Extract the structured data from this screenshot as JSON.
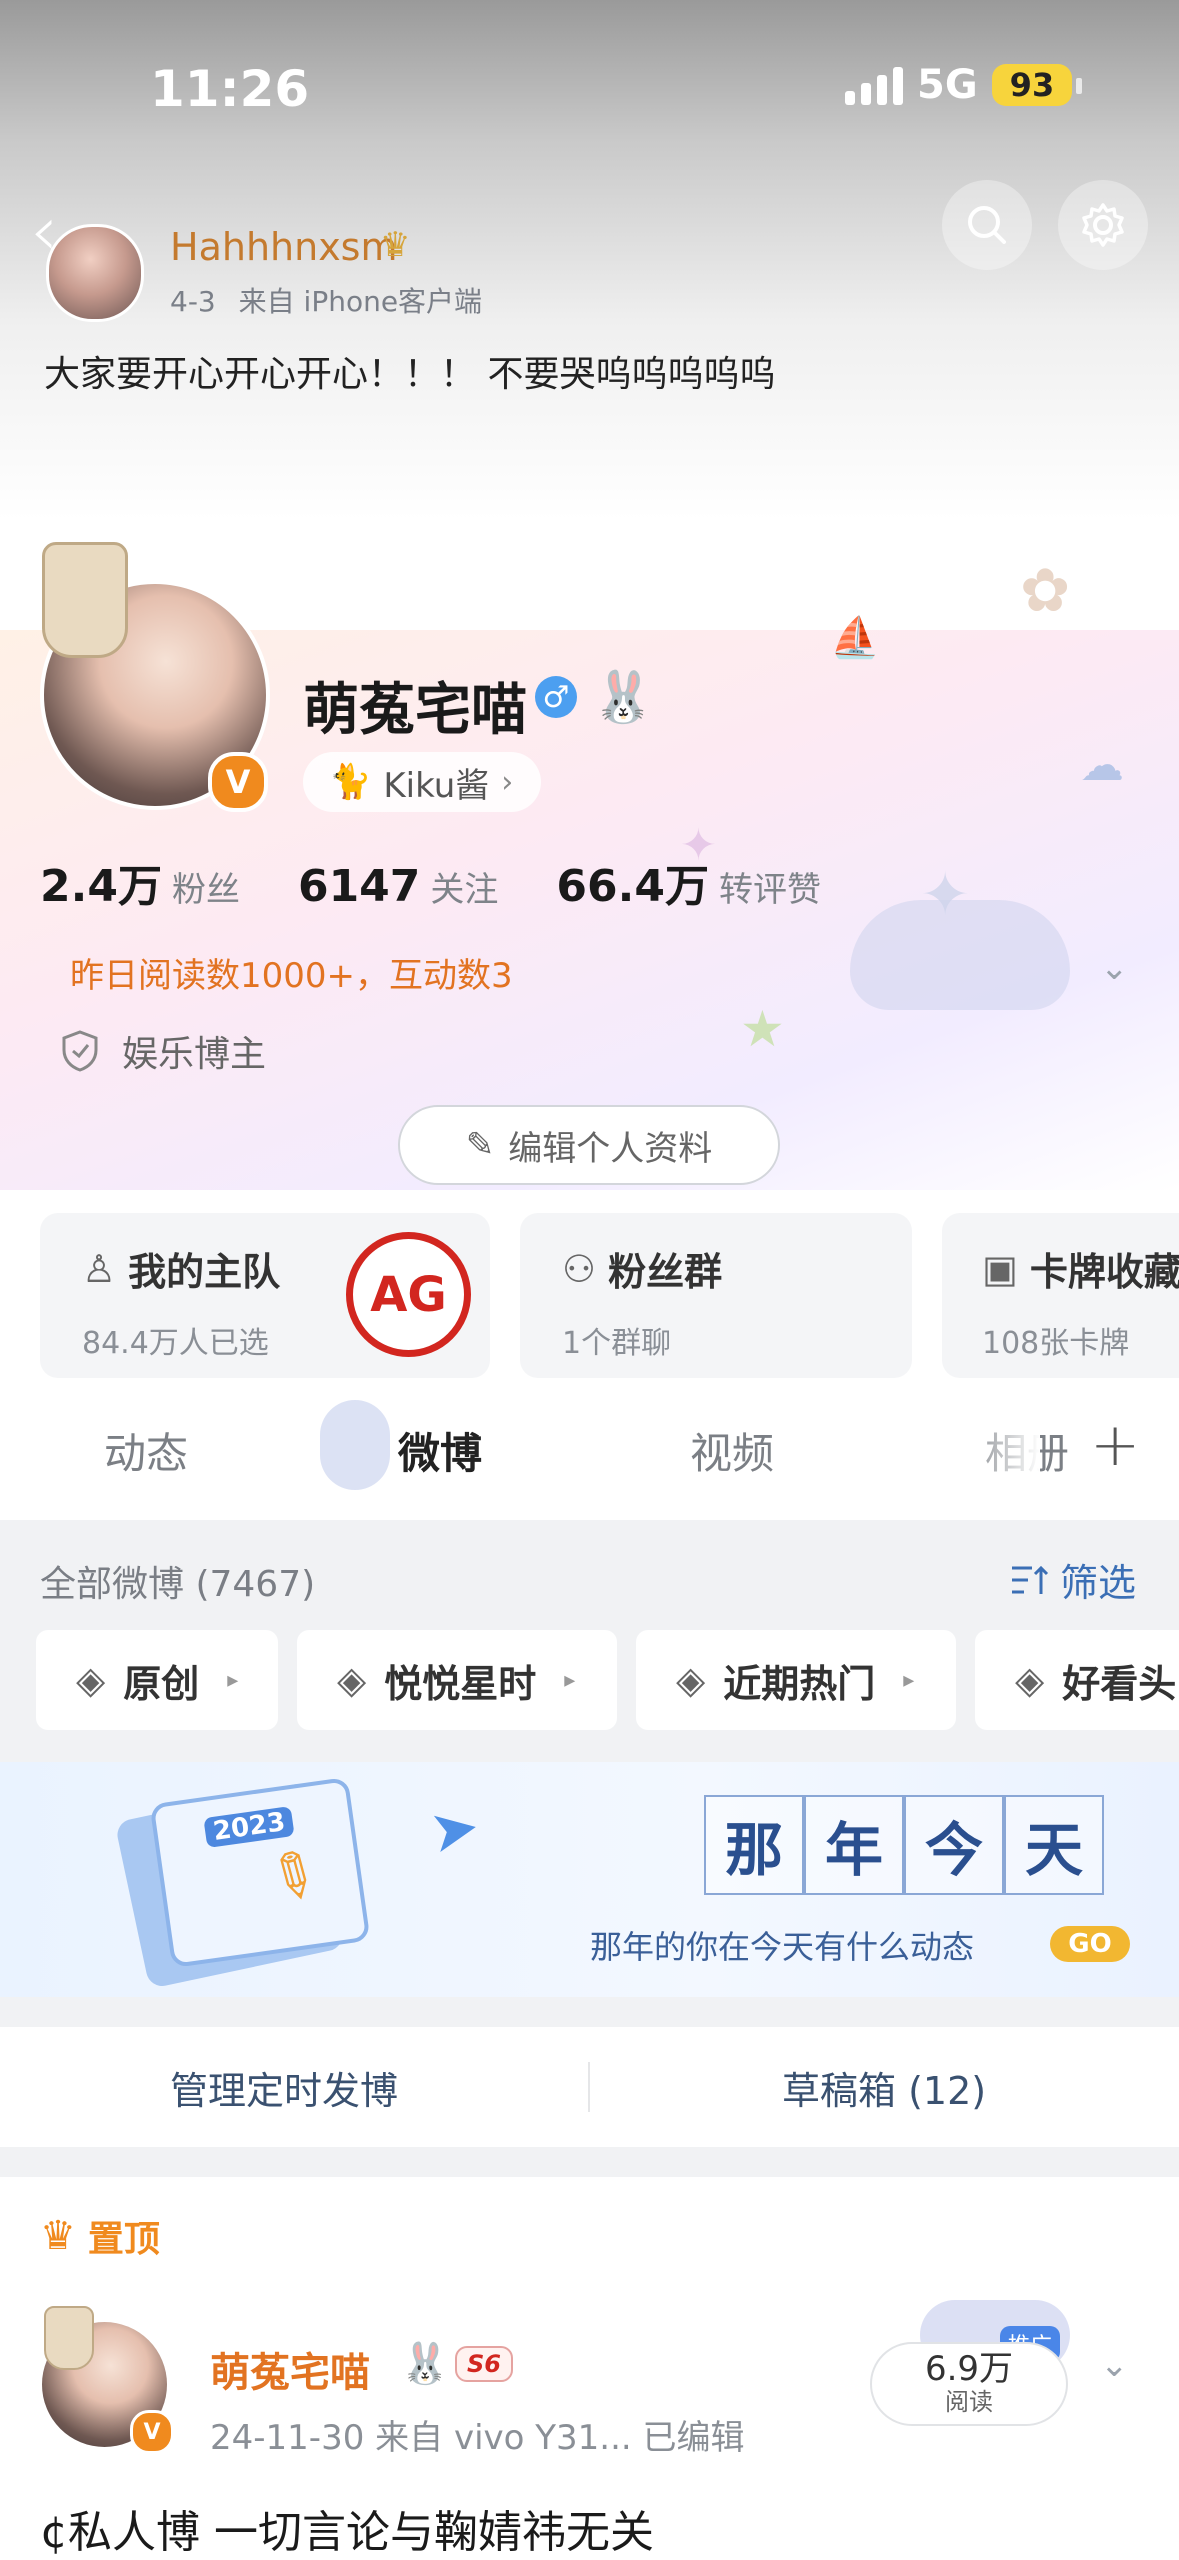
{
  "status_bar": {
    "time": "11:26",
    "network": "5G",
    "battery": "93"
  },
  "repost": {
    "author": "Hahhhnxsm",
    "date": "4-3",
    "source": "来自 iPhone客户端",
    "text": "大家要开心开心开心！！！ 不要哭呜呜呜呜呜"
  },
  "profile": {
    "name": "萌菟宅喵",
    "companion": "Kiku酱",
    "stats": [
      {
        "num": "2.4万",
        "label": "粉丝"
      },
      {
        "num": "6147",
        "label": "关注"
      },
      {
        "num": "66.4万",
        "label": "转评赞"
      }
    ],
    "read_line": "昨日阅读数1000+，互动数3",
    "tagline": "娱乐博主",
    "edit_label": "编辑个人资料"
  },
  "cards": [
    {
      "title": "我的主队",
      "sub": "84.4万人已选"
    },
    {
      "title": "粉丝群",
      "sub": "1个群聊"
    },
    {
      "title": "卡牌收藏",
      "sub": "108张卡牌"
    }
  ],
  "team_logo": "AG",
  "tabs": [
    "动态",
    "微博",
    "视频",
    "相册"
  ],
  "active_tab": 1,
  "all_weibo": "全部微博 (7467)",
  "filter_label": "筛选",
  "chips": [
    "原创",
    "悦悦星时",
    "近期热门",
    "好看头"
  ],
  "banner": {
    "chars": [
      "那",
      "年",
      "今",
      "天"
    ],
    "sub": "那年的你在今天有什么动态",
    "go": "GO",
    "year": "2023"
  },
  "manage": {
    "left": "管理定时发博",
    "right": "草稿箱 (12)"
  },
  "post": {
    "pin_label": "置顶",
    "author": "萌菟宅喵",
    "level": "S6",
    "meta": "24-11-30   来自 vivo Y31...   已编辑",
    "reads_num": "6.9万",
    "reads_label": "阅读",
    "promo": "推广",
    "text": "¢私人博 一切言论与鞠婧祎无关"
  },
  "colors": {
    "accent_orange": "#e27321",
    "link_blue": "#3b6fb5",
    "vip_orange": "#f08a1e"
  }
}
